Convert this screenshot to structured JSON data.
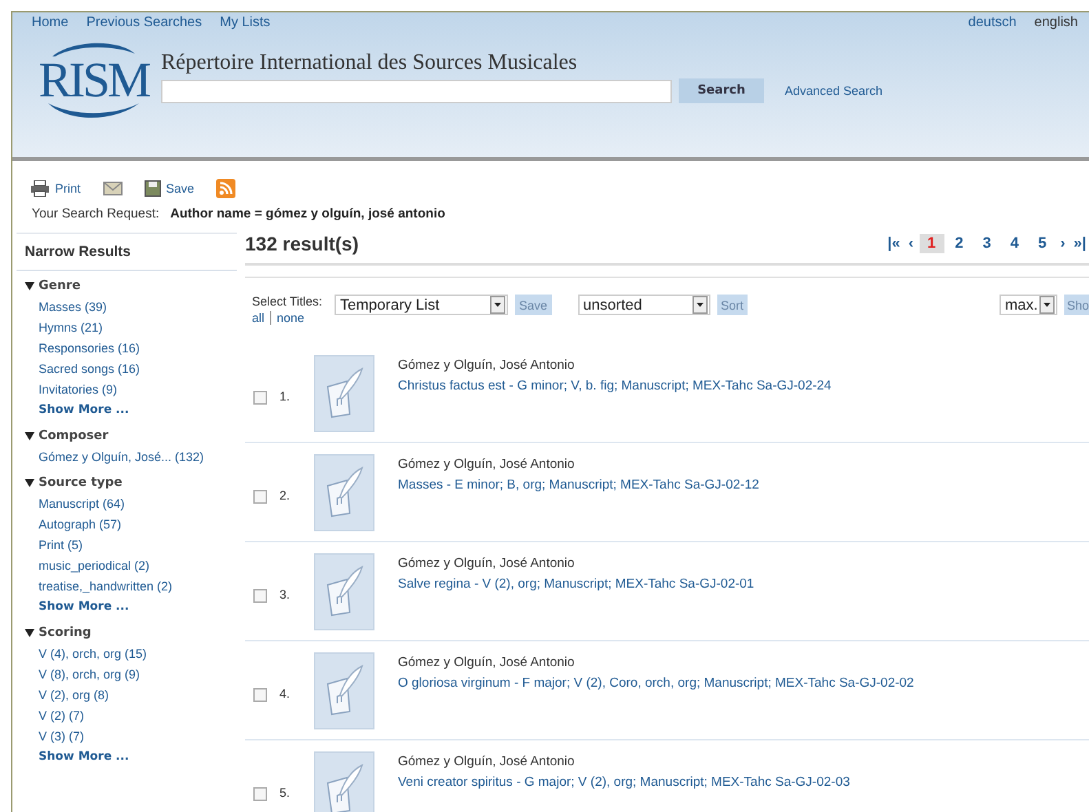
{
  "nav": {
    "links": [
      "Home",
      "Previous Searches",
      "My Lists"
    ],
    "languages": [
      {
        "label": "deutsch",
        "selected": false
      },
      {
        "label": "english",
        "selected": true
      }
    ]
  },
  "header": {
    "logo": "RISM",
    "title": "Répertoire International des Sources Musicales",
    "search_button": "Search",
    "advanced_link": "Advanced Search"
  },
  "toolbar": {
    "print": "Print",
    "save": "Save"
  },
  "search_request": {
    "label": "Your Search Request:",
    "query": "Author name = gómez y olguín, josé antonio"
  },
  "sidebar": {
    "title": "Narrow Results",
    "facets": [
      {
        "title": "Genre",
        "expanded": true,
        "items": [
          "Masses (39)",
          "Hymns (21)",
          "Responsories (16)",
          "Sacred songs (16)",
          "Invitatories (9)"
        ],
        "more": "Show More ..."
      },
      {
        "title": "Composer",
        "expanded": true,
        "items": [
          "Gómez y Olguín, José... (132)"
        ]
      },
      {
        "title": "Source type",
        "expanded": true,
        "items": [
          "Manuscript (64)",
          "Autograph (57)",
          "Print (5)",
          "music_periodical (2)",
          "treatise,_handwritten (2)"
        ],
        "more": "Show More ..."
      },
      {
        "title": "Scoring",
        "expanded": true,
        "items": [
          "V (4), orch, org (15)",
          "V (8), orch, org (9)",
          "V (2), org (8)",
          "V (2) (7)",
          "V (3) (7)"
        ],
        "more": "Show More ..."
      }
    ]
  },
  "results": {
    "count": "132 result(s)",
    "pagination": [
      {
        "label": "|«",
        "kind": "nav"
      },
      {
        "label": "‹",
        "kind": "nav"
      },
      {
        "label": "1",
        "kind": "page",
        "selected": true
      },
      {
        "label": "2",
        "kind": "page",
        "selected": false
      },
      {
        "label": "3",
        "kind": "page",
        "selected": false
      },
      {
        "label": "4",
        "kind": "page",
        "selected": false
      },
      {
        "label": "5",
        "kind": "page",
        "selected": false
      },
      {
        "label": "›",
        "kind": "nav"
      },
      {
        "label": "»|",
        "kind": "nav"
      }
    ],
    "select_label": "Select Titles:",
    "select_all": "all",
    "select_none": "none",
    "list_select": "Temporary List",
    "save_button": "Save",
    "sort_select": "unsorted",
    "sort_button": "Sort",
    "max_select": "max.",
    "show_button": "Sho",
    "rows": [
      {
        "number": "1.",
        "checked": false,
        "author": "Gómez y Olguín, José Antonio",
        "title": "Christus factus est - G minor; V, b. fig; Manuscript; MEX-Tahc Sa-GJ-02-24"
      },
      {
        "number": "2.",
        "checked": false,
        "author": "Gómez y Olguín, José Antonio",
        "title": "Masses - E minor; B, org; Manuscript; MEX-Tahc Sa-GJ-02-12"
      },
      {
        "number": "3.",
        "checked": false,
        "author": "Gómez y Olguín, José Antonio",
        "title": "Salve regina - V (2), org; Manuscript; MEX-Tahc Sa-GJ-02-01"
      },
      {
        "number": "4.",
        "checked": false,
        "author": "Gómez y Olguín, José Antonio",
        "title": "O gloriosa virginum - F major; V (2), Coro, orch, org; Manuscript; MEX-Tahc Sa-GJ-02-02"
      },
      {
        "number": "5.",
        "checked": false,
        "author": "Gómez y Olguín, José Antonio",
        "title": "Veni creator spiritus - G major; V (2), org; Manuscript; MEX-Tahc Sa-GJ-02-03"
      }
    ]
  }
}
